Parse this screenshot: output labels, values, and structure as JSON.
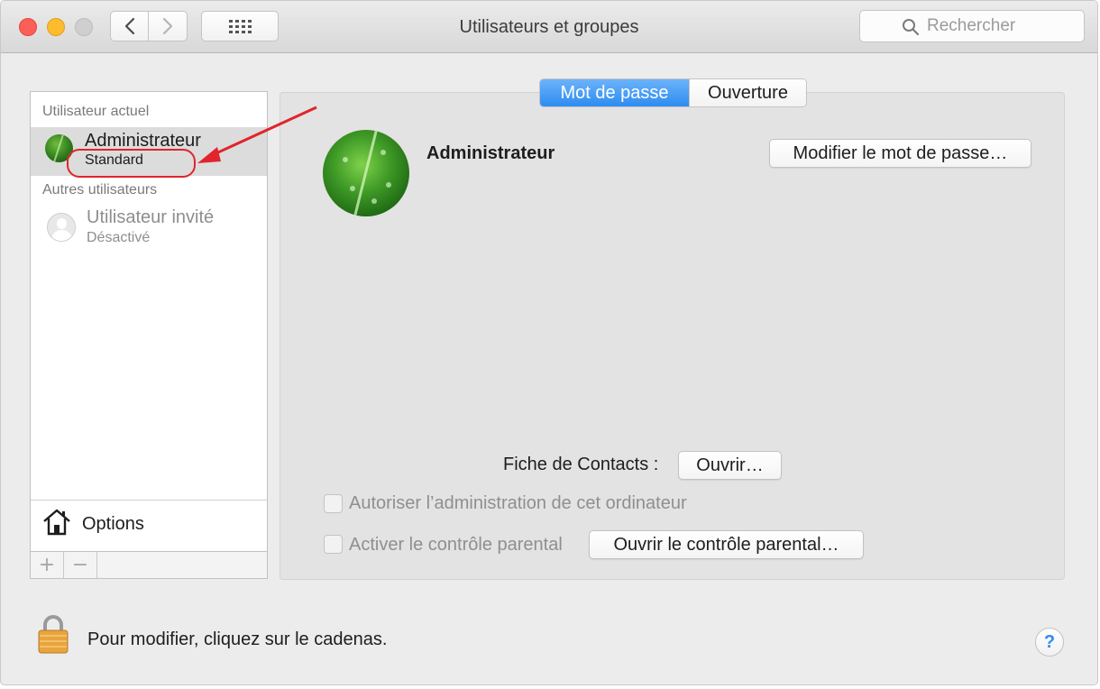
{
  "window": {
    "title": "Utilisateurs et groupes"
  },
  "toolbar": {
    "back_icon": "chevron-left-icon",
    "forward_icon": "chevron-right-icon",
    "grid_icon": "grid-icon",
    "search_placeholder": "Rechercher"
  },
  "sidebar": {
    "current_user_heading": "Utilisateur actuel",
    "current_user": {
      "name": "Administrateur",
      "role": "Standard"
    },
    "other_users_heading": "Autres utilisateurs",
    "guest_user": {
      "name": "Utilisateur invité",
      "status": "Désactivé"
    },
    "options_label": "Options",
    "add_symbol": "+",
    "remove_symbol": "−"
  },
  "tabs": [
    {
      "label": "Mot de passe",
      "active": true
    },
    {
      "label": "Ouverture",
      "active": false
    }
  ],
  "panel": {
    "user_name": "Administrateur",
    "change_password_button": "Modifier le mot de passe…",
    "contacts_label": "Fiche de Contacts :",
    "contacts_button": "Ouvrir…",
    "allow_admin_label": "Autoriser l’administration de cet ordinateur",
    "allow_admin_checked": false,
    "parental_label": "Activer le contrôle parental",
    "parental_checked": false,
    "parental_button": "Ouvrir le contrôle parental…"
  },
  "footer": {
    "lock_text": "Pour modifier, cliquez sur le cadenas.",
    "help_symbol": "?"
  },
  "colors": {
    "accent": "#2d8cf0",
    "annotation": "#e0252c",
    "close": "#fc5f57",
    "minimize": "#fdbc2e"
  }
}
